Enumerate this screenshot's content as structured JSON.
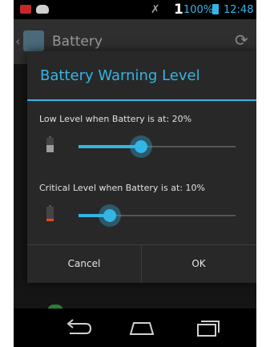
{
  "status_bar": {
    "signal": "1",
    "battery_percent": "100%",
    "time": "12:48"
  },
  "action_bar": {
    "title": "Battery"
  },
  "dialog": {
    "title": "Battery Warning Level",
    "low_level": {
      "label": "Low Level when Battery is at: 20%",
      "value_fraction": 0.4
    },
    "critical_level": {
      "label": "Critical Level when Battery is at: 10%",
      "value_fraction": 0.2
    },
    "buttons": {
      "cancel": "Cancel",
      "ok": "OK"
    }
  },
  "colors": {
    "accent": "#33b5e5",
    "battery_low": "#9e9e9e",
    "battery_critical": "#e64a19"
  },
  "nav_bar": {
    "icons": [
      "back-icon",
      "home-icon",
      "recent-apps-icon"
    ]
  }
}
